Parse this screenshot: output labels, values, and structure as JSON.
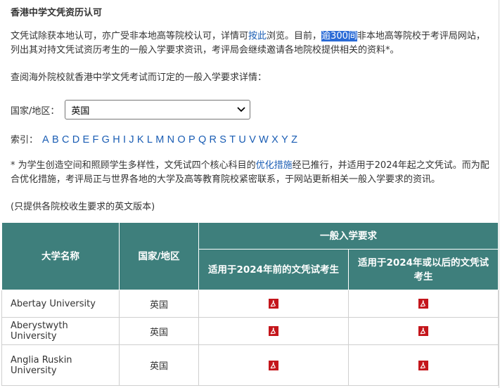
{
  "title": "香港中学文凭资历认可",
  "intro": {
    "text_before_link": "文凭试除获本地认可，亦广受非本地高等院校认可，详情可",
    "link_label": "按此",
    "text_after_link": "浏览。目前，",
    "highlight": "逾300间",
    "text_end": "非本地高等院校于考评局网站，列出其对持文凭试资历考生的一般入学要求资讯，考评局会继续邀请各地院校提供相关的资料*。"
  },
  "lookup_text": "查阅海外院校就香港中学文凭考试而订定的一般入学要求详情：",
  "country_filter": {
    "label": "国家/地区：",
    "selected": "英国"
  },
  "index": {
    "label": "索引：",
    "letters": [
      "A",
      "B",
      "C",
      "D",
      "E",
      "F",
      "G",
      "H",
      "I",
      "J",
      "K",
      "L",
      "M",
      "N",
      "O",
      "P",
      "Q",
      "R",
      "S",
      "T",
      "U",
      "V",
      "W",
      "X",
      "Y",
      "Z"
    ]
  },
  "note": {
    "text_before_link": "* 为学生创造空间和照顾学生多样性，文凭试四个核心科目的",
    "link_label": "优化措施",
    "text_after_link": "经已推行，并适用于2024年起之文凭试。而为配合优化措施，考评局正与世界各地的大学及高等教育院校紧密联系，于网站更新相关一般入学要求的资讯。"
  },
  "english_note": "(只提供各院校收生要求的英文版本)",
  "table": {
    "headers": {
      "university": "大学名称",
      "country": "国家/地区",
      "requirements": "一般入学要求",
      "before_2024": "适用于2024年前的文凭试考生",
      "from_2024": "适用于2024年或以后的文凭试考生"
    },
    "rows": [
      {
        "name": "Abertay University",
        "country": "英国"
      },
      {
        "name": "Aberystwyth University",
        "country": "英国"
      },
      {
        "name": "Anglia Ruskin University",
        "country": "英国"
      }
    ]
  },
  "colors": {
    "header_bg": "#3e7f7c",
    "link": "#1a5db4",
    "highlight": "#2a6bd6",
    "pdf_red": "#c4161c"
  },
  "icons": {
    "pdf": "pdf-icon",
    "dropdown": "chevron-down-icon"
  }
}
